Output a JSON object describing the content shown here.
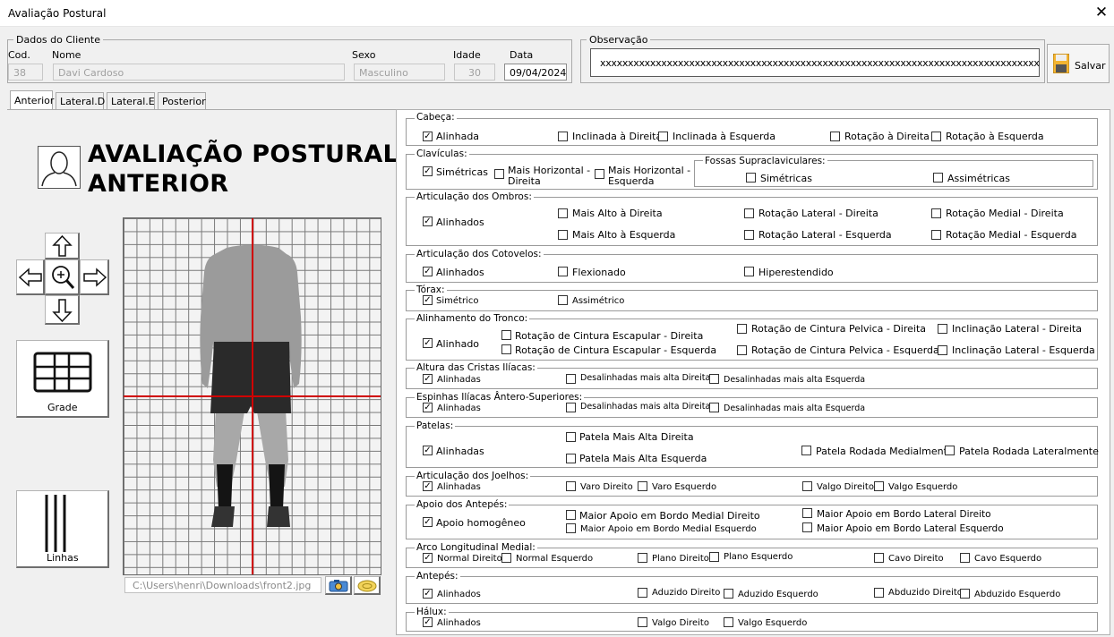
{
  "window": {
    "title": "Avaliação Postural"
  },
  "client": {
    "legend": "Dados do Cliente",
    "cod_label": "Cod.",
    "cod_value": "38",
    "nome_label": "Nome",
    "nome_value": "Davi  Cardoso",
    "sexo_label": "Sexo",
    "sexo_value": "Masculino",
    "idade_label": "Idade",
    "idade_value": "30",
    "data_label": "Data",
    "data_value": "09/04/2024"
  },
  "observacao": {
    "legend": "Observação",
    "value": "xxxxxxxxxxxxxxxxxxxxxxxxxxxxxxxxxxxxxxxxxxxxxxxxxxxxxxxxxxxxxxxxxxxxxxxxxxxxxxxx..."
  },
  "save": {
    "label": "Salvar",
    "icon": "floppy-disk-icon"
  },
  "tabs": [
    {
      "label": "Anterior",
      "active": true
    },
    {
      "label": "Lateral.D",
      "active": false
    },
    {
      "label": "Lateral.E",
      "active": false
    },
    {
      "label": "Posterior",
      "active": false
    }
  ],
  "left": {
    "title_line1": "AVALIAÇÃO POSTURAL",
    "title_line2": "ANTERIOR",
    "grade_label": "Grade",
    "linhas_label": "Linhas",
    "image_path": "C:\\Users\\henri\\Downloads\\front2.jpg",
    "icons": [
      "user-avatar-icon",
      "arrow-up-icon",
      "arrow-down-icon",
      "arrow-left-icon",
      "arrow-right-icon",
      "zoom-icon",
      "grid-icon",
      "lines-icon",
      "camera-icon",
      "clear-icon"
    ]
  },
  "sections": {
    "cabeca": {
      "title": "Cabeça:",
      "items": [
        {
          "label": "Alinhada",
          "checked": true
        },
        {
          "label": "Inclinada à Direita",
          "checked": false
        },
        {
          "label": "Inclinada à Esquerda",
          "checked": false
        },
        {
          "label": "Rotação à Direita",
          "checked": false
        },
        {
          "label": "Rotação à Esquerda",
          "checked": false
        }
      ]
    },
    "claviculas": {
      "title": "Clavículas:",
      "items": [
        {
          "label": "Simétricas",
          "checked": true
        },
        {
          "label": "Mais Horizontal -",
          "label2": "Direita",
          "checked": false
        },
        {
          "label": "Mais Horizontal -",
          "label2": "Esquerda",
          "checked": false
        }
      ],
      "fossas": {
        "title": "Fossas Supraclaviculares:",
        "items": [
          {
            "label": "Simétricas",
            "checked": false
          },
          {
            "label": "Assimétricas",
            "checked": false
          }
        ]
      }
    },
    "ombros": {
      "title": "Articulação dos Ombros:",
      "items": [
        {
          "label": "Alinhados",
          "checked": true
        },
        {
          "label": "Mais Alto  à Direita",
          "checked": false
        },
        {
          "label": "Mais Alto à Esquerda",
          "checked": false
        },
        {
          "label": "Rotação Lateral - Direita",
          "checked": false
        },
        {
          "label": "Rotação Lateral -  Esquerda",
          "checked": false
        },
        {
          "label": "Rotação Medial - Direita",
          "checked": false
        },
        {
          "label": "Rotação Medial -  Esquerda",
          "checked": false
        }
      ]
    },
    "cotovelos": {
      "title": "Articulação dos Cotovelos:",
      "items": [
        {
          "label": "Alinhados",
          "checked": true
        },
        {
          "label": "Flexionado",
          "checked": false
        },
        {
          "label": "Hiperestendido",
          "checked": false
        }
      ]
    },
    "torax": {
      "title": "Tórax:",
      "items": [
        {
          "label": "Simétrico",
          "checked": true
        },
        {
          "label": "Assimétrico",
          "checked": false
        }
      ]
    },
    "tronco": {
      "title": "Alinhamento do Tronco:",
      "items": [
        {
          "label": "Alinhado",
          "checked": true
        },
        {
          "label": "Rotação de Cintura Escapular - Direita",
          "checked": false
        },
        {
          "label": "Rotação de Cintura Escapular - Esquerda",
          "checked": false
        },
        {
          "label": "Rotação de Cintura Pelvica - Direita",
          "checked": false
        },
        {
          "label": "Rotação de Cintura Pelvica - Esquerda",
          "checked": false
        },
        {
          "label": "Inclinação Lateral - Direita",
          "checked": false
        },
        {
          "label": "Inclinação Lateral - Esquerda",
          "checked": false
        }
      ]
    },
    "cristas": {
      "title": "Altura das Cristas Ilíacas:",
      "items": [
        {
          "label": "Alinhadas",
          "checked": true
        },
        {
          "label": "Desalinhadas mais alta Direita",
          "checked": false
        },
        {
          "label": "Desalinhadas mais alta Esquerda",
          "checked": false
        }
      ]
    },
    "espinhas": {
      "title": "Espinhas Ilíacas Ântero-Superiores:",
      "items": [
        {
          "label": "Alinhadas",
          "checked": true
        },
        {
          "label": "Desalinhadas mais alta Direita",
          "checked": false
        },
        {
          "label": "Desalinhadas mais alta Esquerda",
          "checked": false
        }
      ]
    },
    "patelas": {
      "title": "Patelas:",
      "items": [
        {
          "label": "Alinhadas",
          "checked": true
        },
        {
          "label": "Patela Mais Alta Direita",
          "checked": false
        },
        {
          "label": "Patela Mais Alta Esquerda",
          "checked": false
        },
        {
          "label": "Patela Rodada Medialmente",
          "checked": false
        },
        {
          "label": "Patela Rodada Lateralmente",
          "checked": false
        }
      ]
    },
    "joelhos": {
      "title": "Articulação dos Joelhos:",
      "items": [
        {
          "label": "Alinhadas",
          "checked": true
        },
        {
          "label": "Varo Direito",
          "checked": false
        },
        {
          "label": "Varo Esquerdo",
          "checked": false
        },
        {
          "label": "Valgo Direito",
          "checked": false
        },
        {
          "label": "Valgo Esquerdo",
          "checked": false
        }
      ]
    },
    "antepes_apoio": {
      "title": "Apoio dos Antepés:",
      "items": [
        {
          "label": "Apoio homogêneo",
          "checked": true
        },
        {
          "label": "Maior Apoio em Bordo Medial Direito",
          "checked": false
        },
        {
          "label": "Maior Apoio em Bordo Medial Esquerdo",
          "checked": false
        },
        {
          "label": "Maior Apoio em Bordo Lateral Direito",
          "checked": false
        },
        {
          "label": "Maior Apoio em Bordo Lateral Esquerdo",
          "checked": false
        }
      ]
    },
    "arco": {
      "title": "Arco Longitudinal Medial:",
      "items": [
        {
          "label": "Normal Direito",
          "checked": true
        },
        {
          "label": "Normal Esquerdo",
          "checked": false
        },
        {
          "label": "Plano Direito",
          "checked": false
        },
        {
          "label": "Plano Esquerdo",
          "checked": false
        },
        {
          "label": "Cavo Direito",
          "checked": false
        },
        {
          "label": "Cavo Esquerdo",
          "checked": false
        }
      ]
    },
    "antepes": {
      "title": "Antepés:",
      "items": [
        {
          "label": "Alinhados",
          "checked": true
        },
        {
          "label": "Aduzido Direito",
          "checked": false
        },
        {
          "label": "Aduzido Esquerdo",
          "checked": false
        },
        {
          "label": "Abduzido Direito",
          "checked": false
        },
        {
          "label": "Abduzido Esquerdo",
          "checked": false
        }
      ]
    },
    "halux": {
      "title": "Hálux:",
      "items": [
        {
          "label": "Alinhados",
          "checked": true
        },
        {
          "label": "Valgo Direito",
          "checked": false
        },
        {
          "label": "Valgo Esquerdo",
          "checked": false
        }
      ]
    }
  }
}
